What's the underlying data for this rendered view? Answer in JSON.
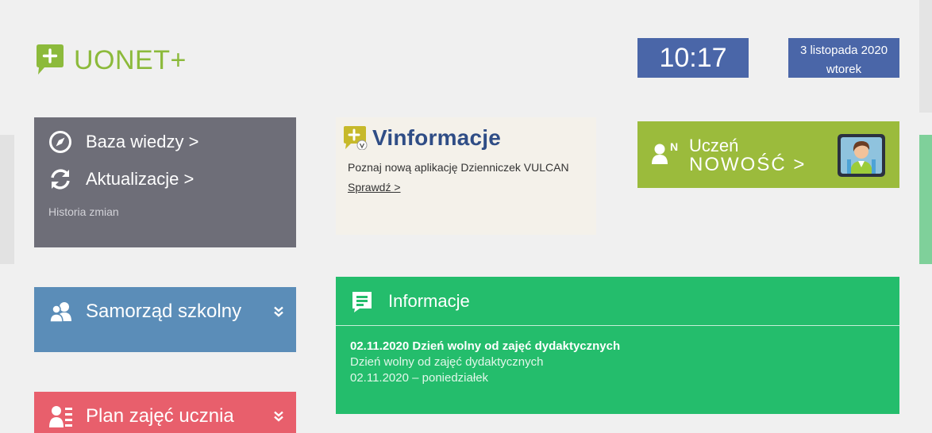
{
  "header": {
    "logo_text": "UONET+",
    "time": "10:17",
    "date": "3 listopada 2020",
    "weekday": "wtorek"
  },
  "help_tile": {
    "knowledge_base": "Baza wiedzy >",
    "updates": "Aktualizacje >",
    "history": "Historia zmian"
  },
  "vinformacje": {
    "title": "Vinformacje",
    "description": "Poznaj nową aplikację Dzienniczek VULCAN",
    "link": "Sprawdź >"
  },
  "uczen": {
    "line1": "Uczeń",
    "line2": "NOWOŚĆ >",
    "badge": "N"
  },
  "modules": {
    "samorzad": "Samorząd szkolny",
    "plan": "Plan zajęć ucznia"
  },
  "informacje": {
    "title": "Informacje",
    "items": [
      {
        "title": "02.11.2020 Dzień wolny od zajęć dydaktycznych",
        "description": "Dzień wolny od zajęć dydaktycznych",
        "date": "02.11.2020 – poniedziałek"
      }
    ]
  },
  "colors": {
    "background": "#f0f0f0",
    "logo_green": "#8cba3b",
    "clock_blue": "#4a66a8",
    "help_gray": "#6e6e78",
    "uczen_green": "#9bbb3c",
    "samorzad_blue": "#5b8db8",
    "plan_red": "#e85f6c",
    "info_green": "#24bd6c",
    "vinfo_title": "#2f4d86"
  },
  "icons": {
    "logo": "speech-bubble-plus-icon",
    "knowledge_base": "compass-icon",
    "updates": "refresh-icon",
    "vinformacje": "vulcan-plus-icon",
    "uczen": "student-badge-icon",
    "samorzad": "group-icon",
    "plan": "student-list-icon",
    "chevron": "double-chevron-down-icon",
    "informacje": "document-icon"
  }
}
